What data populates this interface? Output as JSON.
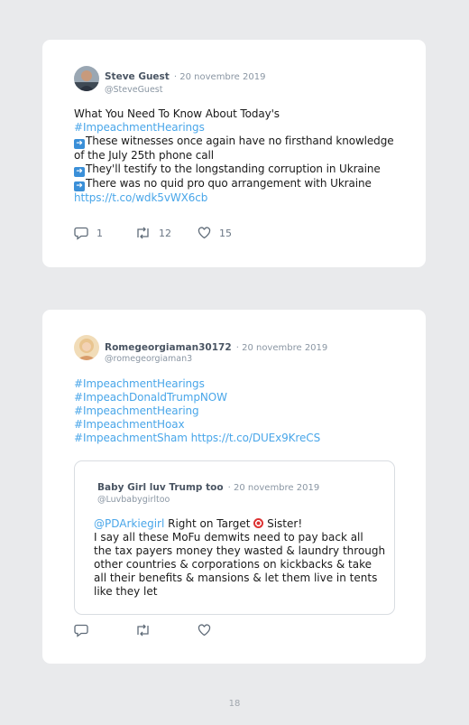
{
  "tweet1": {
    "user": "Steve Guest",
    "date": "· 20 novembre 2019",
    "handle": "@SteveGuest",
    "lines": [
      "What You Need To Know About Today's",
      "These witnesses once again have no firsthand knowledge",
      "of the July 25th phone call",
      "They'll testify to the longstanding corruption in Ukraine",
      "There was no quid pro quo arrangement with Ukraine"
    ],
    "hashtag": "#ImpeachmentHearings",
    "link": "https://t.co/wdk5vWX6cb",
    "replies": "1",
    "retweets": "12",
    "likes": "15"
  },
  "tweet2": {
    "user": "Romegeorgiaman30172",
    "date": "· 20 novembre 2019",
    "handle": "@romegeorgiaman3",
    "hashtags": [
      "#ImpeachmentHearings",
      "#ImpeachDonaldTrumpNOW",
      "#ImpeachmentHearing",
      "#ImpeachmentHoax",
      "#ImpeachmentSham"
    ],
    "link": "https://t.co/DUEx9KreCS",
    "quote": {
      "user": "Baby Girl luv Trump too",
      "date": "· 20 novembre 2019",
      "handle": "@Luvbabygirltoo",
      "mention": "@PDArkiegirl",
      "first_line_rest": "Right on Target",
      "first_line_end": "Sister!",
      "lines": [
        "I say all these MoFu demwits need to pay back all",
        "the tax payers money they wasted & laundry through",
        "other countries & corporations on kickbacks & take",
        "all their benefits & mansions & let them live in tents",
        "like they let"
      ]
    }
  },
  "page_number": "18"
}
